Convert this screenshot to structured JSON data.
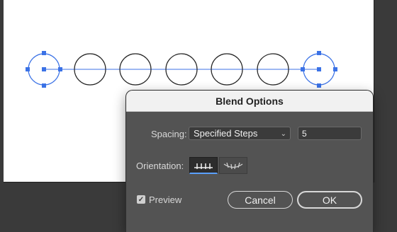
{
  "dialog": {
    "title": "Blend Options",
    "spacing_label": "Spacing:",
    "spacing_value": "Specified Steps",
    "steps_value": "5",
    "orientation_label": "Orientation:",
    "preview_label": "Preview",
    "preview_checked": true,
    "cancel_label": "Cancel",
    "ok_label": "OK"
  },
  "colors": {
    "selection": "#3b72e6",
    "dialog_bg": "#535353",
    "titlebar_bg": "#f1f1f1"
  },
  "artwork": {
    "blend_steps_shown": 5
  }
}
